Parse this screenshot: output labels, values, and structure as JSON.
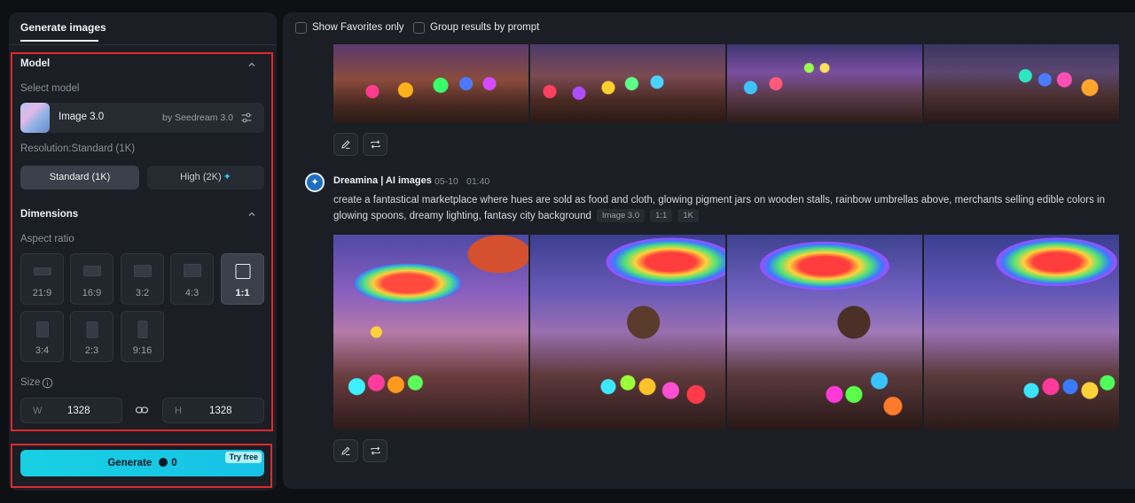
{
  "sidebar": {
    "tab_label": "Generate images",
    "model_section": {
      "title": "Model",
      "select_label": "Select model",
      "model_name": "Image 3.0",
      "model_by": "by Seedream 3.0",
      "resolution_label": "Resolution:Standard (1K)",
      "resolution_options": [
        "Standard (1K)",
        "High (2K)"
      ],
      "resolution_selected": "Standard (1K)"
    },
    "dimensions_section": {
      "title": "Dimensions",
      "aspect_label": "Aspect ratio",
      "ratios": [
        "21:9",
        "16:9",
        "3:2",
        "4:3",
        "1:1",
        "3:4",
        "2:3",
        "9:16"
      ],
      "ratio_selected": "1:1",
      "size_label": "Size",
      "width_prefix": "W",
      "width_value": "1328",
      "height_prefix": "H",
      "height_value": "1328"
    },
    "generate": {
      "label": "Generate",
      "credits": "0",
      "badge": "Try free"
    }
  },
  "results": {
    "filters": {
      "show_favorites": "Show Favorites only",
      "group_by_prompt": "Group results by prompt"
    },
    "entry": {
      "author": "Dreamina | AI images",
      "date": "05-10",
      "time": "01:40",
      "prompt": "create a fantastical marketplace where hues are sold as food and cloth, glowing pigment jars on wooden stalls, rainbow umbrellas above, merchants selling edible colors in glowing spoons, dreamy lighting, fantasy city background",
      "tags": [
        "Image 3.0",
        "1:1",
        "1K"
      ]
    }
  },
  "colors": {
    "accent": "#19d0e3",
    "highlight_border": "#e0282e"
  }
}
